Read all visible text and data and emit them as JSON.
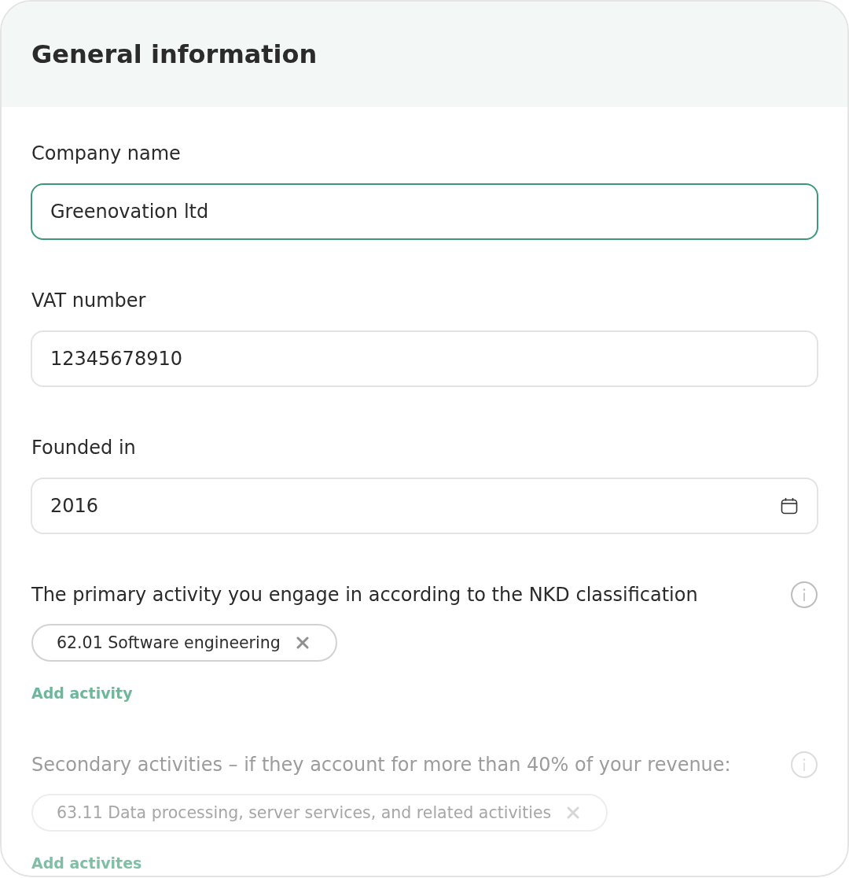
{
  "title": "General information",
  "fields": [
    {
      "kind": "text",
      "label": "Company name",
      "value": "Greenovation ltd",
      "focused": true,
      "disabled": false
    },
    {
      "kind": "text",
      "label": "VAT number",
      "value": "12345678910",
      "focused": false,
      "disabled": false
    },
    {
      "kind": "date",
      "label": "Founded in",
      "value": "2016",
      "focused": false,
      "disabled": false
    },
    {
      "kind": "tags",
      "label": "The primary activity you engage in according to the NKD classification",
      "tags": [
        "62.01 Software engineering"
      ],
      "add_link": "Add activity",
      "focused": false,
      "disabled": false
    },
    {
      "kind": "tags",
      "label": "Secondary activities – if they account for more than 40% of your revenue:",
      "tags": [
        "63.11 Data processing, server services, and related activities"
      ],
      "add_link": "Add activites",
      "focused": false,
      "disabled": true
    }
  ]
}
